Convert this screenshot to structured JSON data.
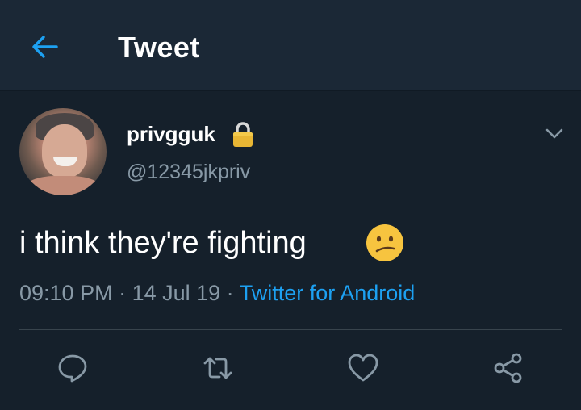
{
  "header": {
    "title": "Tweet",
    "back_icon": "arrow-left-icon"
  },
  "tweet": {
    "display_name": "privgguk",
    "handle": "@12345jkpriv",
    "text": "i think they're fighting",
    "emoji": "confused-face-emoji",
    "time": "09:10 PM",
    "date": "14 Jul 19",
    "separator": " · ",
    "source": "Twitter for Android"
  },
  "actions": [
    {
      "name": "reply",
      "icon": "reply-icon"
    },
    {
      "name": "retweet",
      "icon": "retweet-icon"
    },
    {
      "name": "like",
      "icon": "heart-icon"
    },
    {
      "name": "share",
      "icon": "share-icon"
    }
  ],
  "colors": {
    "background": "#15202b",
    "header": "#1b2836",
    "accent": "#1da1f2",
    "secondary_text": "#8899a6",
    "divider": "#38444d"
  }
}
